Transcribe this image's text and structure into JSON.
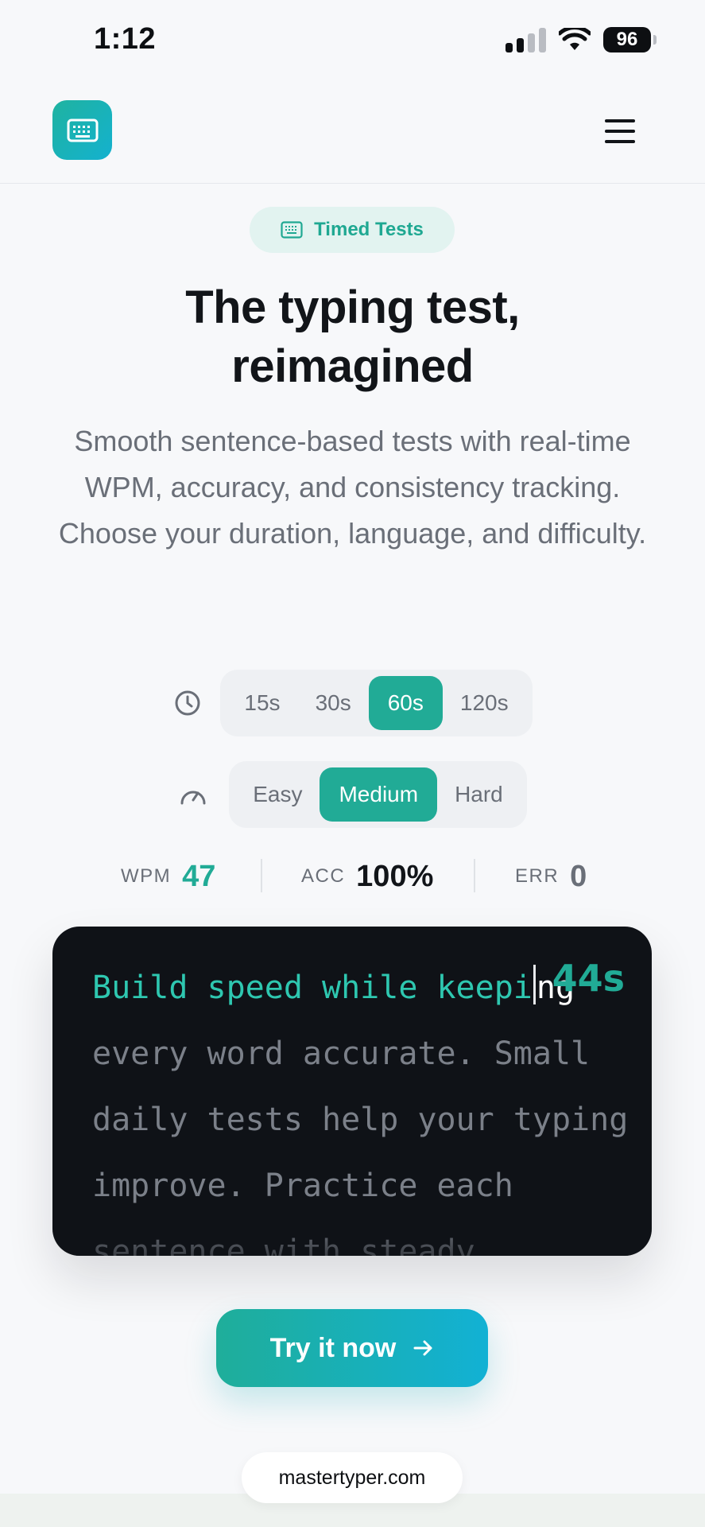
{
  "status_bar": {
    "time": "1:12",
    "battery": "96"
  },
  "header": {
    "logo_icon": "keyboard-icon",
    "menu_icon": "hamburger-icon"
  },
  "badge": {
    "icon": "keyboard-icon",
    "label": "Timed Tests"
  },
  "hero": {
    "title_line1": "The typing test,",
    "title_line2": "reimagined",
    "subtitle": "Smooth sentence-based tests with real-time WPM, accuracy, and consistency tracking. Choose your duration, language, and difficulty."
  },
  "durations": {
    "icon": "clock-icon",
    "options": [
      "15s",
      "30s",
      "60s",
      "120s"
    ],
    "selected": "60s"
  },
  "difficulty": {
    "icon": "gauge-icon",
    "options": [
      "Easy",
      "Medium",
      "Hard"
    ],
    "selected": "Medium"
  },
  "stats": {
    "wpm_label": "WPM",
    "wpm_value": "47",
    "acc_label": "ACC",
    "acc_value": "100%",
    "err_label": "ERR",
    "err_value": "0"
  },
  "typing_box": {
    "timer": "44s",
    "typed_text": "Build speed while keepi",
    "current_text": "ng",
    "remaining_text": " every word accurate. Small daily tests help your typing improve. Practice each sentence with steady"
  },
  "cta": {
    "label": "Try it now",
    "icon": "arrow-right-icon"
  },
  "footer": {
    "url": "mastertyper.com"
  },
  "colors": {
    "accent": "#21ab96",
    "accent_end": "#12b1d4",
    "dark_panel": "#0f1217"
  }
}
